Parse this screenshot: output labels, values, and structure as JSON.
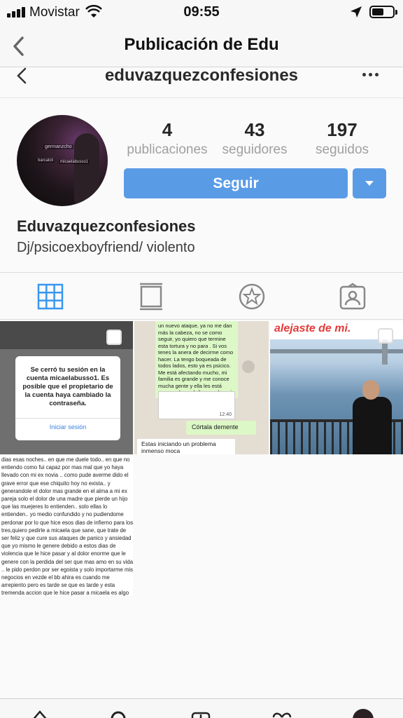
{
  "status_bar": {
    "carrier": "Movistar",
    "time": "09:55",
    "icons": [
      "signal-icon",
      "wifi-icon",
      "location-arrow-icon",
      "battery-icon"
    ]
  },
  "nav": {
    "title": "Publicación de Edu",
    "back_icon": "chevron-left-icon"
  },
  "profile": {
    "username": "eduvazquezconfesiones",
    "avatar_labels": [
      "germanzcho",
      "micaelabusso1",
      "barcalcli"
    ],
    "stats": [
      {
        "value": "4",
        "label": "publicaciones"
      },
      {
        "value": "43",
        "label": "seguidores"
      },
      {
        "value": "197",
        "label": "seguidos"
      }
    ],
    "follow_label": "Seguir",
    "full_name": "Eduvazquezconfesiones",
    "bio": "Dj/psicoexboyfriend/ violento"
  },
  "tabs": [
    "grid-icon",
    "feed-icon",
    "star-icon",
    "tagged-icon"
  ],
  "posts": {
    "post1": {
      "dialog_text": "Se cerró tu sesión en la cuenta micaelabusso1. Es posible que el propietario de la cuenta haya cambiado la contraseña.",
      "action": "Iniciar sesión"
    },
    "post2": {
      "chat_text": "un nuevo ataque, ya no me dan más la cabeza, no se como seguir, yo quiero que termine esta tortura y no para . Si vos tenes la anera de decirme como hacer. La tengo boqueada de todos lados, esto ya es psicico. Me está afectando mucho, mi familia es grande y me conoce mucha gente y ella les está generando un daño no solo ami sino a todas ireparable .",
      "timestamp": "12:40",
      "reply": "Córtala demente",
      "incoming": "Estas iniciando un problema inmenso moca"
    },
    "post3": {
      "caption": "alejaste de mi."
    },
    "post4": {
      "letter": "dias esas noches.. en que me duele todo.. en que no entiendo como fui capaz por mas mal que yo haya llevado con mi ex novia .. como pude averme dido el grave error que ese chiquito hoy no exista.. y generandole el dolor mas grande en el alma a mi ex pareja solo el dolor de una madre que pierde un hijo que las muejeres lo entienden.. solo ellas lo entienden.. yo medio confundido y no pudiendome perdonar por lo que hice esos dias de infierno para los tres,quiero pedirle a micaela que sane, que trate de ser feliz y que cure sus ataques de panico y ansiedad que yo mismo le genere debido a estos dias de violencia que le hice pasar y al dolor enorme que le genere con la perdida del ser que mas amo en su vida .. le pido perdon por ser egoista y solo importarme mis negocios en vezde el bb ahira es cuando me arrepiento pero es tarde se que es tarde y esta tremenda accion que le hice pasar a micaela es algo aue jamas me lo fordonara o espero que alguna vez si ya nose!"
    }
  },
  "bottom_tabs": [
    "home-icon",
    "search-icon",
    "add-icon",
    "heart-icon",
    "profile-avatar-icon"
  ],
  "colors": {
    "accent": "#5a9be6",
    "caption_red": "#e33a3a",
    "chat_green": "#dcf8c6"
  }
}
